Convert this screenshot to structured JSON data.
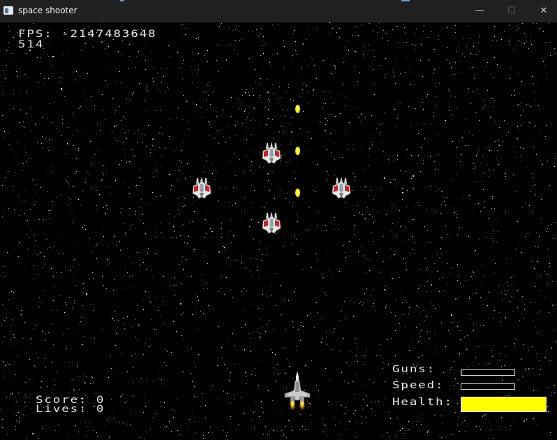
{
  "window": {
    "title": "space shooter",
    "controls": {
      "minimize": "—",
      "maximize": "☐",
      "close": "✕"
    }
  },
  "hud": {
    "fps_text": "FPS: -2147483648",
    "frame_text": "514",
    "score_text": "Score:  0",
    "lives_text": "Lives:  0",
    "guns_label": "Guns:",
    "speed_label": "Speed:",
    "health_label": "Health:",
    "guns_level": 0.01,
    "speed_level": 0.0,
    "health_level": 1.0
  },
  "colors": {
    "background": "#000000",
    "hud_text": "#e6e6e6",
    "health_fill": "#ffff00",
    "guns_fill": "#c0392b",
    "bullet": "#ffee00",
    "titlebar": "#202020"
  },
  "entities": {
    "enemy_count": 4,
    "bullet_count": 3,
    "player_icon": "player-ship-icon",
    "enemy_icon": "enemy-ship-icon"
  }
}
